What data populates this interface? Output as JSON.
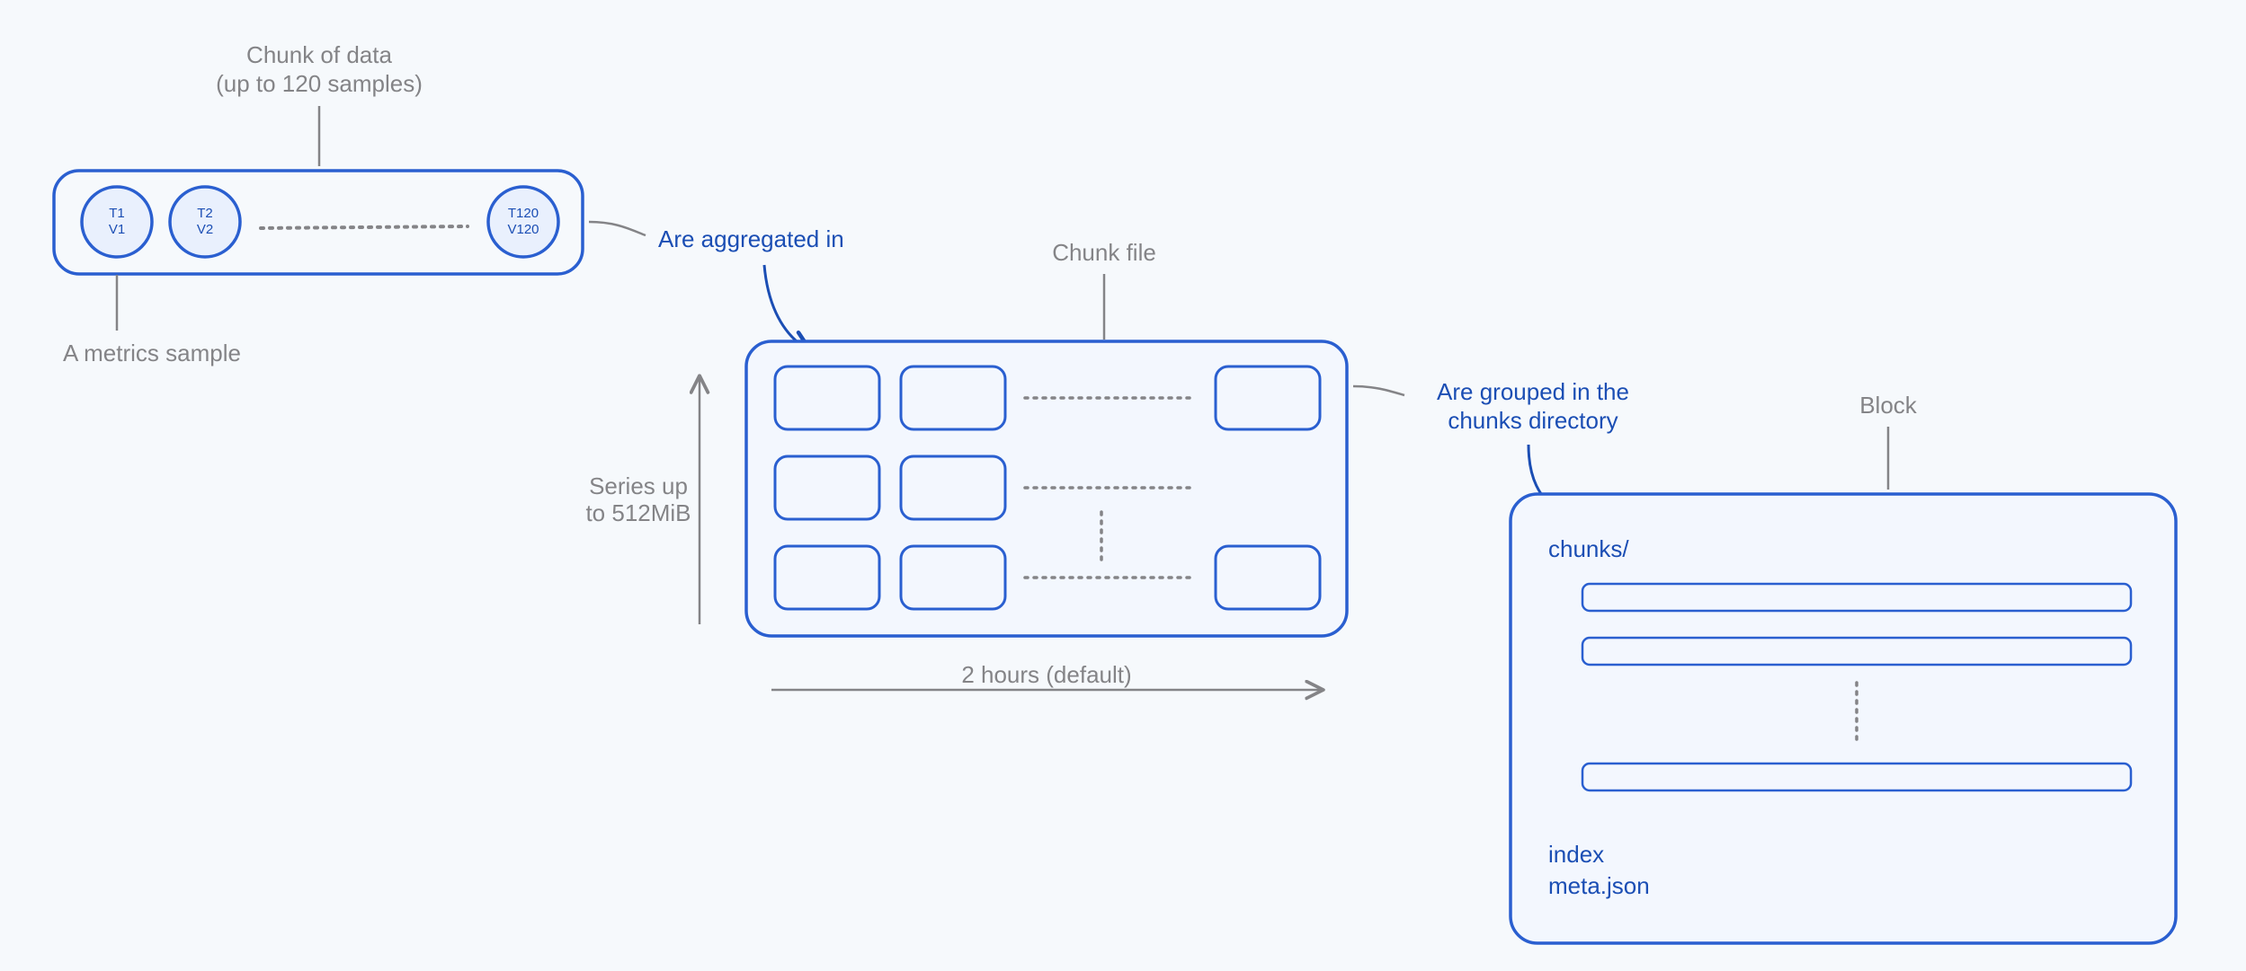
{
  "chunk": {
    "title_l1": "Chunk of data",
    "title_l2": "(up to 120 samples)",
    "samples": {
      "s1": {
        "t": "T1",
        "v": "V1"
      },
      "s2": {
        "t": "T2",
        "v": "V2"
      },
      "s3": {
        "t": "T120",
        "v": "V120"
      }
    },
    "below": "A metrics sample"
  },
  "arrow1_label": "Are aggregated in",
  "chunkfile_label": "Chunk file",
  "axis_y_l1": "Series up",
  "axis_y_l2": "to 512MiB",
  "axis_x": "2 hours (default)",
  "arrow2_l1": "Are grouped in the",
  "arrow2_l2": "chunks directory",
  "block": {
    "title": "Block",
    "dir": "chunks/",
    "file1": "index",
    "file2": "meta.json"
  }
}
